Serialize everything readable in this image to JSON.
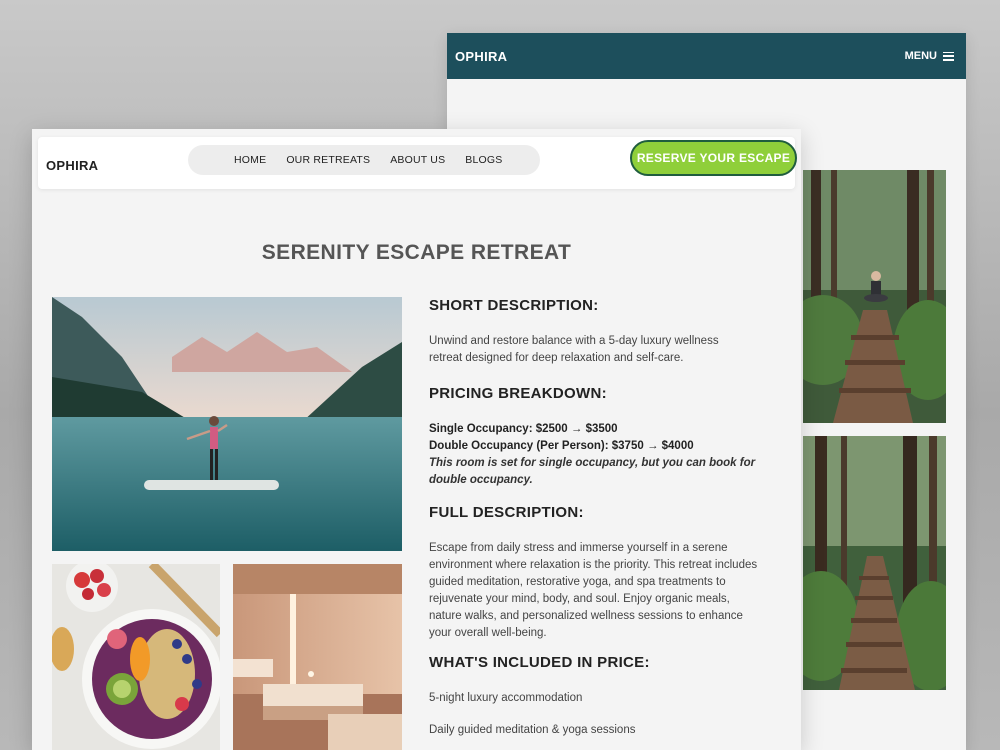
{
  "mobile": {
    "logo": "OPHIRA",
    "menu_label": "MENU",
    "images": [
      "forest meditation path image",
      "forest stairway path image"
    ]
  },
  "desktop": {
    "logo": "OPHIRA",
    "nav": [
      "HOME",
      "OUR RETREATS",
      "ABOUT US",
      "BLOGS"
    ],
    "cta": "RESERVE YOUR ESCAPE",
    "title": "SERENITY ESCAPE RETREAT",
    "sections": {
      "short_heading": "SHORT DESCRIPTION:",
      "short_text": "Unwind and restore balance with a 5-day luxury wellness retreat designed for deep relaxation and self-care.",
      "pricing_heading": "PRICING BREAKDOWN:",
      "pricing_single": "Single Occupancy: $2500 → $3500",
      "pricing_double": "Double Occupancy (Per Person): $3750 → $4000",
      "pricing_note": "This room is set for single occupancy, but you can book for double occupancy.",
      "full_heading": "FULL DESCRIPTION:",
      "full_text": "Escape from daily stress and immerse yourself in a serene environment where relaxation is the priority. This retreat includes guided meditation, restorative yoga, and spa treatments to rejuvenate your mind, body, and soul. Enjoy organic meals, nature walks, and personalized wellness sessions to enhance your overall well-being.",
      "included_heading": "WHAT'S INCLUDED IN PRICE:",
      "included_items": [
        "5-night luxury accommodation",
        "Daily guided meditation & yoga sessions"
      ]
    }
  },
  "colors": {
    "mobile_header": "#1d4f5c",
    "cta_fill": "#8fcf3a",
    "cta_border": "#1f5d3e"
  }
}
